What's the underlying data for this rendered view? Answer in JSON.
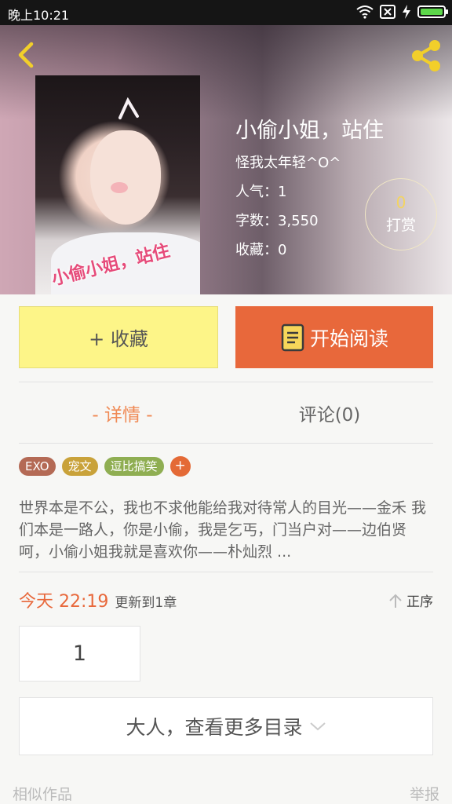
{
  "status_bar": {
    "time": "晚上10:21",
    "battery_color": "#5dd84a"
  },
  "header": {
    "title": "小偷小姐，站住",
    "author": "怪我太年轻^O^",
    "popularity": "人气：1",
    "word_count": "字数：3,550",
    "favorites": "收藏：0",
    "cover_text": "小偷小姐，站住",
    "tip": {
      "count": "0",
      "label": "打赏"
    }
  },
  "actions": {
    "favorite_label": "+ 收藏",
    "read_label": "开始阅读"
  },
  "tabs": [
    {
      "label": "- 详情 -",
      "active": true
    },
    {
      "label": "评论(0)",
      "active": false
    }
  ],
  "tags": [
    {
      "label": "EXO",
      "color": "#b46a55"
    },
    {
      "label": "宠文",
      "color": "#c9a23a"
    },
    {
      "label": "逗比搞笑",
      "color": "#8fae52"
    }
  ],
  "tag_add_label": "+",
  "description": "世界本是不公，我也不求他能给我对待常人的目光——金禾  我们本是一路人，你是小偷，我是乞丐，门当户对——边伯贤 呵，小偷小姐我就是喜欢你——朴灿烈 ...",
  "update": {
    "when": "今天 22:19",
    "text": "更新到1章",
    "order_label": "正序"
  },
  "chapters": [
    "1"
  ],
  "more_catalog": "大人，查看更多目录",
  "footer": {
    "similar": "相似作品",
    "report": "举报"
  },
  "colors": {
    "accent_orange": "#e8683b",
    "fav_yellow": "#fdf588",
    "active_tab": "#f08a55"
  },
  "icons": {
    "back": "chevron-left-icon",
    "share": "share-icon",
    "book": "book-icon",
    "order": "arrow-up-icon",
    "more": "chevron-down-icon"
  }
}
